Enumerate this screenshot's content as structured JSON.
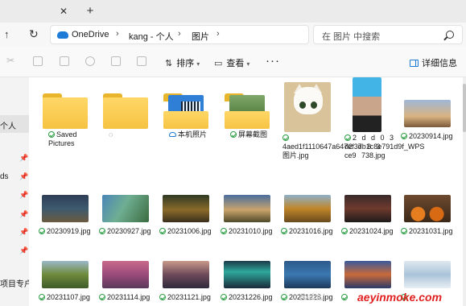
{
  "tabbar": {
    "close_glyph": "✕",
    "new_tab_glyph": "+"
  },
  "addressbar": {
    "up_glyph": "↑",
    "refresh_glyph": "↻",
    "crumbs": [
      "OneDrive",
      "kang - 个人",
      "图片"
    ],
    "separator": "›",
    "search_placeholder": "在 图片 中搜索"
  },
  "commandbar": {
    "sort_label": "排序",
    "view_label": "查看",
    "more_label": "···",
    "details_label": "详细信息"
  },
  "sidebar": {
    "items": [
      {
        "label": "个人",
        "selected": true
      },
      {
        "label": ""
      },
      {
        "label": "ds"
      },
      {
        "label": ""
      },
      {
        "label": ""
      },
      {
        "label": ""
      },
      {
        "label": ""
      },
      {
        "label": "项目专户"
      }
    ]
  },
  "files": {
    "row1": [
      {
        "name": "Saved Pictures",
        "kind": "folder",
        "status": "synced"
      },
      {
        "name": "",
        "kind": "folder",
        "status": "pending"
      },
      {
        "name": "本机照片",
        "kind": "folder",
        "status": "cloud"
      },
      {
        "name": "屏幕截图",
        "kind": "folder",
        "status": "synced"
      },
      {
        "name": "4aed1f1110647a647ef37b1c8e791d9f_WPS图片.jpg",
        "kind": "image",
        "status": "synced"
      },
      {
        "name": "2 d d 0 3 d2 d 8 3 ce9 738.jpg",
        "kind": "image",
        "status": "synced"
      },
      {
        "name": "20230914.jpg",
        "kind": "image",
        "status": "synced"
      }
    ],
    "row2": [
      {
        "name": "20230919.jpg",
        "status": "synced"
      },
      {
        "name": "20230927.jpg",
        "status": "synced"
      },
      {
        "name": "20231006.jpg",
        "status": "synced"
      },
      {
        "name": "20231010.jpg",
        "status": "synced"
      },
      {
        "name": "20231016.jpg",
        "status": "synced"
      },
      {
        "name": "20231024.jpg",
        "status": "synced"
      },
      {
        "name": "20231031.jpg",
        "status": "synced"
      }
    ],
    "row3": [
      {
        "name": "20231107.jpg",
        "status": "synced"
      },
      {
        "name": "20231114.jpg",
        "status": "synced"
      },
      {
        "name": "20231121.jpg",
        "status": "synced"
      },
      {
        "name": "20231226.jpg",
        "status": "synced"
      },
      {
        "name": "20231228.jpg",
        "status": "synced"
      },
      {
        "name": "",
        "status": "synced"
      },
      {
        "name": "",
        "status": "synced"
      }
    ]
  },
  "watermark": {
    "text": "aeyinmoke.com",
    "faint": "Baidu"
  }
}
